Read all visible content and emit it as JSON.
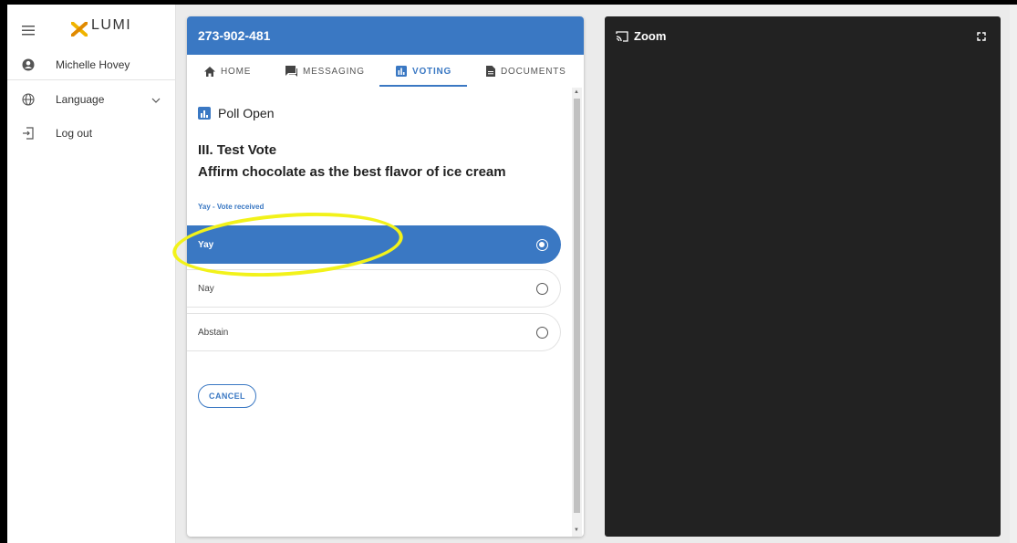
{
  "sidebar": {
    "logo": "LUMI",
    "user_name": "Michelle Hovey",
    "language_label": "Language",
    "logout_label": "Log out"
  },
  "panel": {
    "meeting_id": "273-902-481",
    "tabs": [
      {
        "label": "HOME",
        "icon": "home-icon"
      },
      {
        "label": "MESSAGING",
        "icon": "chat-icon"
      },
      {
        "label": "VOTING",
        "icon": "bar-chart-icon",
        "active": true
      },
      {
        "label": "DOCUMENTS",
        "icon": "document-icon"
      }
    ],
    "poll_status": "Poll Open",
    "resolution_number": "III. Test Vote",
    "resolution_text": "Affirm chocolate as the best flavor of ice cream",
    "vote_status": "Yay - Vote received",
    "options": [
      {
        "label": "Yay",
        "selected": true
      },
      {
        "label": "Nay",
        "selected": false
      },
      {
        "label": "Abstain",
        "selected": false
      }
    ],
    "cancel_label": "CANCEL"
  },
  "zoom": {
    "title": "Zoom"
  },
  "colors": {
    "accent": "#3a78c3",
    "highlight": "#f2f21a",
    "zoom_bg": "#222222"
  }
}
